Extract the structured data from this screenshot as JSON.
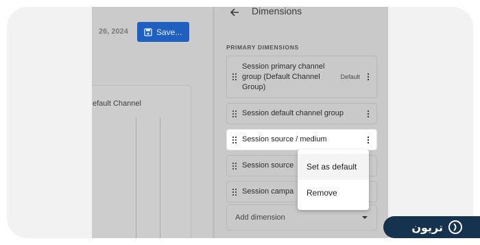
{
  "report": {
    "date_fragment": "26, 2024",
    "save_label": "Save...",
    "chart_label": "efault Channel"
  },
  "panel": {
    "title": "Dimensions",
    "section_label": "PRIMARY DIMENSIONS",
    "rows": [
      {
        "label": "Session primary channel group (Default Channel Group)",
        "badge": "Default"
      },
      {
        "label": "Session default channel group"
      },
      {
        "label": "Session source / medium"
      },
      {
        "label": "Session source"
      },
      {
        "label": "Session campa"
      }
    ],
    "add_placeholder": "Add dimension"
  },
  "menu": {
    "set_default_label": "Set as default",
    "remove_label": "Remove"
  },
  "brand": {
    "logo_text": "تریون"
  },
  "colors": {
    "save_button": "#1f5fbf",
    "overlay_gray": "#c9c9c9",
    "card_bg": "#f3f2f2",
    "logo_bg": "#15324f"
  }
}
